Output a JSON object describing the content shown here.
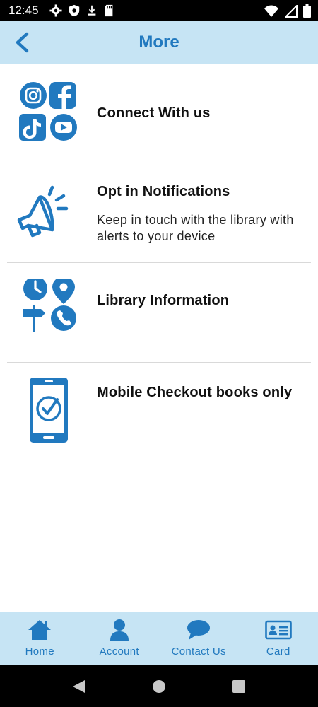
{
  "status_bar": {
    "time": "12:45"
  },
  "header": {
    "title": "More"
  },
  "items": [
    {
      "title": "Connect With us",
      "icon": "social-media-icon"
    },
    {
      "title": "Opt in Notifications",
      "description": "Keep in touch with the library with alerts to your device",
      "icon": "megaphone-icon"
    },
    {
      "title": "Library Information",
      "icon": "library-info-icon"
    },
    {
      "title": "Mobile Checkout   books only",
      "icon": "mobile-checkout-icon"
    }
  ],
  "tabs": [
    {
      "label": "Home",
      "icon": "home-icon"
    },
    {
      "label": "Account",
      "icon": "account-icon"
    },
    {
      "label": "Contact Us",
      "icon": "chat-bubble-icon"
    },
    {
      "label": "Card",
      "icon": "id-card-icon"
    }
  ],
  "colors": {
    "accent": "#2179bf",
    "header_bg": "#c6e4f4"
  }
}
